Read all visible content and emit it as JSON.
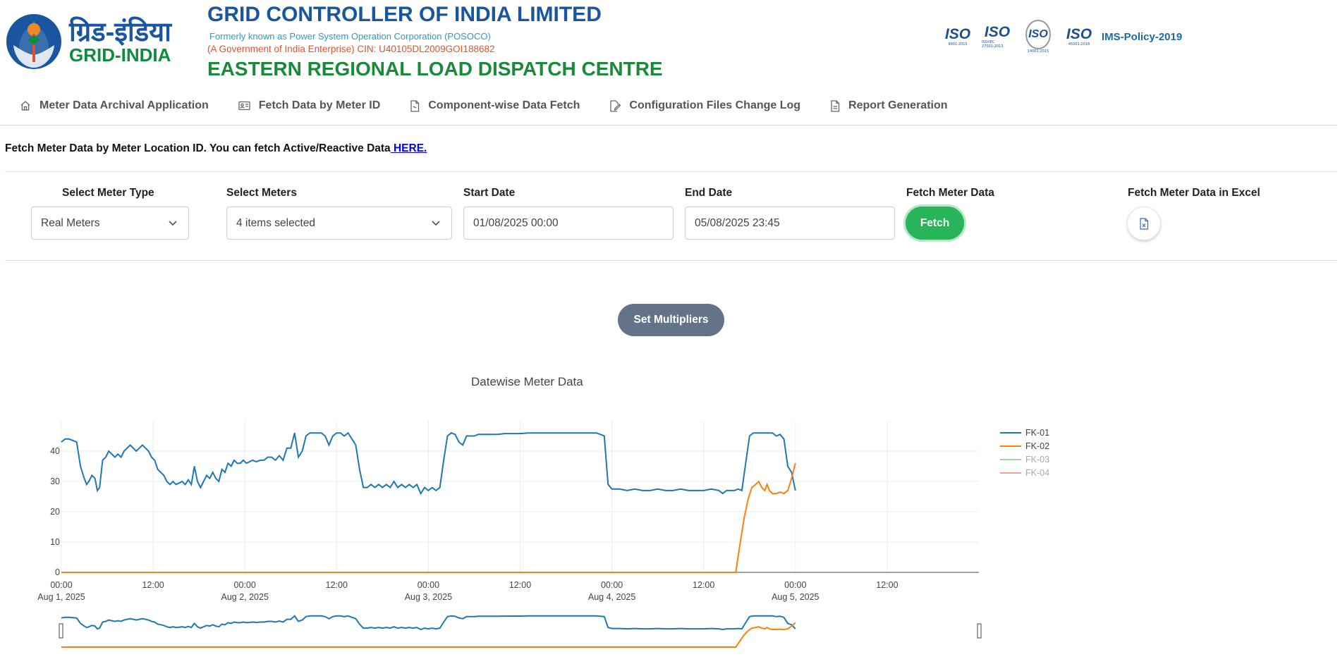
{
  "header": {
    "brand_hindi": "ग्रिड-इंडिया",
    "brand_english": "GRID-INDIA",
    "org_title": "GRID CONTROLLER OF INDIA LIMITED",
    "formerly": "Formerly known as Power System Operation Corporation (POSOCO)",
    "government": "(A Government of India Enterprise) CIN: U40105DL2009GOI188682",
    "centre": "EASTERN REGIONAL LOAD DISPATCH CENTRE",
    "iso_badges": [
      {
        "word": "ISO",
        "num": "9001:2015"
      },
      {
        "word": "ISO",
        "num": "ISO/IEC 27001:2013"
      },
      {
        "word": "ISO",
        "num": "14001:2015"
      },
      {
        "word": "ISO",
        "num": "45001:2018"
      }
    ],
    "ims_policy": "IMS-Policy-2019"
  },
  "nav": {
    "items": [
      {
        "label": "Meter Data Archival Application",
        "icon": "home-icon"
      },
      {
        "label": "Fetch Data by Meter ID",
        "icon": "id-card-icon"
      },
      {
        "label": "Component-wise Data Fetch",
        "icon": "document-icon"
      },
      {
        "label": "Configuration Files Change Log",
        "icon": "edit-icon"
      },
      {
        "label": "Report Generation",
        "icon": "report-icon"
      }
    ]
  },
  "intro": {
    "text": "Fetch Meter Data by Meter Location ID. You can fetch Active/Reactive Data",
    "link": " HERE."
  },
  "form": {
    "meter_type_label": "Select Meter Type",
    "meter_type_value": "Real Meters",
    "meters_label": "Select Meters",
    "meters_value": "4 items selected",
    "start_label": "Start Date",
    "start_value": "01/08/2025 00:00",
    "end_label": "End Date",
    "end_value": "05/08/2025 23:45",
    "fetch_label": "Fetch Meter Data",
    "fetch_button": "Fetch",
    "excel_label": "Fetch Meter Data in Excel"
  },
  "multipliers_button": "Set Multipliers",
  "chart_data": {
    "type": "line",
    "title": "Datewise Meter Data",
    "xlabel": "",
    "ylabel": "",
    "ylim": [
      0,
      50
    ],
    "y_ticks": [
      0,
      10,
      20,
      30,
      40
    ],
    "x_tick_labels": [
      {
        "time": "00:00",
        "date": "Aug 1, 2025"
      },
      {
        "time": "12:00",
        "date": ""
      },
      {
        "time": "00:00",
        "date": "Aug 2, 2025"
      },
      {
        "time": "12:00",
        "date": ""
      },
      {
        "time": "00:00",
        "date": "Aug 3, 2025"
      },
      {
        "time": "12:00",
        "date": ""
      },
      {
        "time": "00:00",
        "date": "Aug 4, 2025"
      },
      {
        "time": "12:00",
        "date": ""
      },
      {
        "time": "00:00",
        "date": "Aug 5, 2025"
      },
      {
        "time": "12:00",
        "date": ""
      }
    ],
    "x_range_hours": [
      0,
      120
    ],
    "grid": true,
    "legend_position": "right",
    "range_slider": true,
    "series": [
      {
        "name": "FK-01",
        "color": "#1f77b4",
        "visible": true,
        "points": [
          [
            0,
            43
          ],
          [
            0.5,
            44
          ],
          [
            1,
            44
          ],
          [
            1.5,
            43.5
          ],
          [
            2,
            43
          ],
          [
            2.5,
            35
          ],
          [
            3,
            31
          ],
          [
            3.3,
            29
          ],
          [
            3.6,
            30
          ],
          [
            4,
            32
          ],
          [
            4.4,
            31
          ],
          [
            4.7,
            27
          ],
          [
            5,
            28
          ],
          [
            5.4,
            37
          ],
          [
            5.8,
            38
          ],
          [
            6.2,
            40
          ],
          [
            6.6,
            39
          ],
          [
            7,
            38
          ],
          [
            7.4,
            39
          ],
          [
            7.8,
            38
          ],
          [
            8.2,
            40
          ],
          [
            8.6,
            41
          ],
          [
            9,
            42
          ],
          [
            9.4,
            41
          ],
          [
            9.8,
            40
          ],
          [
            10.2,
            41
          ],
          [
            10.6,
            42
          ],
          [
            11,
            41
          ],
          [
            11.4,
            40
          ],
          [
            11.8,
            38
          ],
          [
            12.2,
            37
          ],
          [
            12.6,
            34
          ],
          [
            13,
            33
          ],
          [
            13.4,
            32
          ],
          [
            13.8,
            30
          ],
          [
            14.2,
            29
          ],
          [
            14.6,
            30
          ],
          [
            15,
            29
          ],
          [
            15.4,
            29.5
          ],
          [
            15.8,
            30
          ],
          [
            16.2,
            29
          ],
          [
            16.6,
            30.5
          ],
          [
            17,
            29
          ],
          [
            17.4,
            35
          ],
          [
            17.8,
            30
          ],
          [
            18.2,
            28
          ],
          [
            18.6,
            30
          ],
          [
            19,
            32
          ],
          [
            19.4,
            31
          ],
          [
            19.8,
            33
          ],
          [
            20.2,
            31
          ],
          [
            20.6,
            30
          ],
          [
            21,
            34
          ],
          [
            21.4,
            33
          ],
          [
            21.8,
            36
          ],
          [
            22.2,
            35
          ],
          [
            22.6,
            37
          ],
          [
            23,
            36
          ],
          [
            23.4,
            36
          ],
          [
            23.8,
            37
          ],
          [
            24.2,
            36
          ],
          [
            24.6,
            36.5
          ],
          [
            25,
            37
          ],
          [
            25.5,
            36.5
          ],
          [
            26,
            37
          ],
          [
            26.5,
            37
          ],
          [
            27,
            38
          ],
          [
            27.5,
            38
          ],
          [
            28,
            37
          ],
          [
            28.5,
            38.5
          ],
          [
            29,
            37
          ],
          [
            29.5,
            41
          ],
          [
            30,
            41
          ],
          [
            30.5,
            46
          ],
          [
            31,
            38
          ],
          [
            31.5,
            40
          ],
          [
            32,
            45
          ],
          [
            32.5,
            46
          ],
          [
            33,
            46
          ],
          [
            33.5,
            46
          ],
          [
            34,
            46
          ],
          [
            34.5,
            45
          ],
          [
            35,
            42
          ],
          [
            35.5,
            45
          ],
          [
            36,
            46
          ],
          [
            36.5,
            46
          ],
          [
            37,
            45
          ],
          [
            37.5,
            46
          ],
          [
            38,
            44
          ],
          [
            38.5,
            42
          ],
          [
            39,
            34
          ],
          [
            39.5,
            28
          ],
          [
            40,
            28
          ],
          [
            40.5,
            29
          ],
          [
            41,
            28
          ],
          [
            41.5,
            29
          ],
          [
            42,
            28
          ],
          [
            42.5,
            29
          ],
          [
            43,
            28
          ],
          [
            43.5,
            30
          ],
          [
            44,
            28
          ],
          [
            44.5,
            29
          ],
          [
            45,
            28
          ],
          [
            45.5,
            29
          ],
          [
            46,
            28
          ],
          [
            46.5,
            29
          ],
          [
            47,
            26
          ],
          [
            47.5,
            28
          ],
          [
            48,
            27
          ],
          [
            48.5,
            28
          ],
          [
            49,
            27
          ],
          [
            49.5,
            28
          ],
          [
            50,
            37
          ],
          [
            50.5,
            45
          ],
          [
            51,
            46
          ],
          [
            51.5,
            45.5
          ],
          [
            52,
            43
          ],
          [
            52.5,
            42
          ],
          [
            53,
            45
          ],
          [
            53.5,
            45
          ],
          [
            54,
            45
          ],
          [
            54.5,
            45.5
          ],
          [
            55,
            45.5
          ],
          [
            56,
            45.5
          ],
          [
            57,
            45.5
          ],
          [
            58,
            45.8
          ],
          [
            59,
            45.8
          ],
          [
            60,
            45.8
          ],
          [
            61,
            46
          ],
          [
            62,
            46
          ],
          [
            63,
            46
          ],
          [
            64,
            46
          ],
          [
            65,
            46
          ],
          [
            66,
            46
          ],
          [
            67,
            46
          ],
          [
            68,
            46
          ],
          [
            69,
            46
          ],
          [
            70,
            46
          ],
          [
            71,
            45
          ],
          [
            71.5,
            29
          ],
          [
            72,
            27.5
          ],
          [
            73,
            27.5
          ],
          [
            74,
            27
          ],
          [
            75,
            27.5
          ],
          [
            76,
            27
          ],
          [
            77,
            27
          ],
          [
            78,
            27.5
          ],
          [
            79,
            27
          ],
          [
            80,
            27
          ],
          [
            81,
            27.5
          ],
          [
            82,
            27
          ],
          [
            83,
            27
          ],
          [
            84,
            27
          ],
          [
            85,
            27.5
          ],
          [
            86,
            27
          ],
          [
            86.5,
            26
          ],
          [
            87,
            27
          ],
          [
            88,
            27
          ],
          [
            88.5,
            27.5
          ],
          [
            89,
            27
          ],
          [
            89.5,
            36
          ],
          [
            90,
            45
          ],
          [
            90.5,
            46
          ],
          [
            91,
            46
          ],
          [
            92,
            46
          ],
          [
            93,
            46
          ],
          [
            93.5,
            45
          ],
          [
            94,
            45.5
          ],
          [
            94.5,
            44
          ],
          [
            95,
            35
          ],
          [
            95.5,
            33
          ],
          [
            96,
            27
          ]
        ]
      },
      {
        "name": "FK-02",
        "color": "#ff7f0e",
        "visible": true,
        "points": [
          [
            0,
            0
          ],
          [
            20,
            0
          ],
          [
            40,
            0
          ],
          [
            60,
            0
          ],
          [
            80,
            0
          ],
          [
            87.5,
            0
          ],
          [
            88.2,
            0
          ],
          [
            88.8,
            10
          ],
          [
            89.3,
            18
          ],
          [
            89.8,
            24
          ],
          [
            90.3,
            28
          ],
          [
            90.8,
            29
          ],
          [
            91.2,
            30
          ],
          [
            91.6,
            28
          ],
          [
            92,
            27
          ],
          [
            92.3,
            29
          ],
          [
            92.6,
            27
          ],
          [
            93,
            26
          ],
          [
            93.5,
            26
          ],
          [
            94,
            26.5
          ],
          [
            94.5,
            26
          ],
          [
            95,
            27
          ],
          [
            95.5,
            31
          ],
          [
            96,
            36
          ]
        ]
      },
      {
        "name": "FK-03",
        "color": "#2ca02c",
        "visible": false,
        "points": []
      },
      {
        "name": "FK-04",
        "color": "#d62728",
        "visible": false,
        "points": []
      }
    ]
  }
}
